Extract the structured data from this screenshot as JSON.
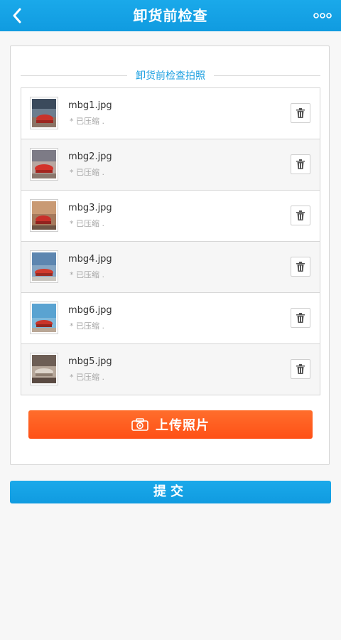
{
  "header": {
    "title": "卸货前检查",
    "back_icon": "chevron-left-icon",
    "more_icon": "more-dots-icon",
    "color": "#15a3e6"
  },
  "section": {
    "title": "卸货前检查拍照"
  },
  "photos": [
    {
      "name": "mbg1.jpg",
      "status": "* 已压缩 ."
    },
    {
      "name": "mbg2.jpg",
      "status": "* 已压缩 ."
    },
    {
      "name": "mbg3.jpg",
      "status": "* 已压缩 ."
    },
    {
      "name": "mbg4.jpg",
      "status": "* 已压缩 ."
    },
    {
      "name": "mbg6.jpg",
      "status": "* 已压缩 ."
    },
    {
      "name": "mbg5.jpg",
      "status": "* 已压缩 ."
    }
  ],
  "upload_button": {
    "label": "上传照片",
    "icon": "camera-icon",
    "color": "#ff5a1e"
  },
  "submit_button": {
    "label": "提交",
    "color": "#15a3e6"
  },
  "delete_icon": "trash-icon"
}
